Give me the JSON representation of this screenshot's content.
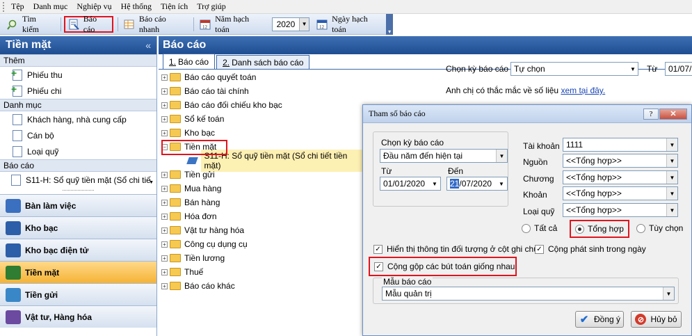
{
  "menu": [
    "Tệp",
    "Danh mục",
    "Nghiệp vụ",
    "Hệ thống",
    "Tiện ích",
    "Trợ giúp"
  ],
  "toolbar": {
    "search": "Tìm kiếm",
    "report": "Báo cáo",
    "quick_report": "Báo cáo nhanh",
    "fiscal_year_label": "Năm hạch toán",
    "fiscal_year_value": "2020",
    "posting_date": "Ngày hạch toán"
  },
  "left_panel": {
    "title": "Tiền mặt",
    "collapse": "«",
    "sections": {
      "add": {
        "title": "Thêm",
        "items": [
          "Phiếu thu",
          "Phiếu chi"
        ]
      },
      "catalog": {
        "title": "Danh mục",
        "items": [
          "Khách hàng, nhà cung cấp",
          "Cán bộ",
          "Loại quỹ"
        ]
      },
      "report": {
        "title": "Báo cáo",
        "items": [
          "S11-H: Sổ quỹ tiền mặt (Sổ chi tiế"
        ]
      }
    },
    "nav": [
      "Bàn làm việc",
      "Kho bạc",
      "Kho bạc điện tử",
      "Tiền mặt",
      "Tiền gửi",
      "Vật tư, Hàng hóa"
    ]
  },
  "main": {
    "title": "Báo cáo",
    "tabs": [
      {
        "num": "1.",
        "label": "Báo cáo"
      },
      {
        "num": "2.",
        "label": "Danh sách báo cáo"
      }
    ],
    "tree": [
      "Báo cáo quyết toán",
      "Báo cáo tài chính",
      "Báo cáo đối chiếu kho bạc",
      "Sổ kế toán",
      "Kho bạc",
      "Tiền mặt",
      "S11-H: Sổ quỹ tiền mặt (Sổ chi tiết tiền mặt)",
      "Tiền gửi",
      "Mua hàng",
      "Bán hàng",
      "Hóa đơn",
      "Vật tư hàng hóa",
      "Công cụ dụng cụ",
      "Tiền lương",
      "Thuế",
      "Báo cáo khác"
    ],
    "period_label": "Chọn kỳ báo cáo",
    "period_value": "Tự chọn",
    "from_label": "Từ",
    "from_value": "01/07/",
    "question": "Anh chị có thắc mắc về số liệu",
    "question_link": "xem tại đây."
  },
  "dialog": {
    "title": "Tham số báo cáo",
    "help": "?",
    "close": "✕",
    "period_label": "Chọn kỳ báo cáo",
    "period_value": "Đầu năm đến hiện tại",
    "from_label": "Từ",
    "from_value": "01/01/2020",
    "to_label": "Đến",
    "to_value_hl": "21",
    "to_value_rest": "/07/2020",
    "account_label": "Tài khoản",
    "account_value": "1111",
    "source_label": "Nguồn",
    "source_value": "<<Tổng hợp>>",
    "chapter_label": "Chương",
    "chapter_value": "<<Tổng hợp>>",
    "item_label": "Khoản",
    "item_value": "<<Tổng hợp>>",
    "fund_label": "Loại quỹ",
    "fund_value": "<<Tổng hợp>>",
    "radio_all": "Tất cả",
    "radio_sum": "Tổng hợp",
    "radio_custom": "Tùy chọn",
    "chk_show_obj": "Hiển thị thông tin đối tượng ở cột ghi chú",
    "chk_daily": "Cộng phát sinh trong ngày",
    "chk_merge": "Cộng gộp các bút toán giống nhau",
    "template_label": "Mẫu báo cáo",
    "template_value": "Mẫu quản trị",
    "ok": "Đồng ý",
    "cancel": "Hủy bỏ"
  },
  "colors": {
    "highlight_red": "#e0141d",
    "header_blue": "#1f4d91",
    "active_nav": "#f5b335"
  }
}
